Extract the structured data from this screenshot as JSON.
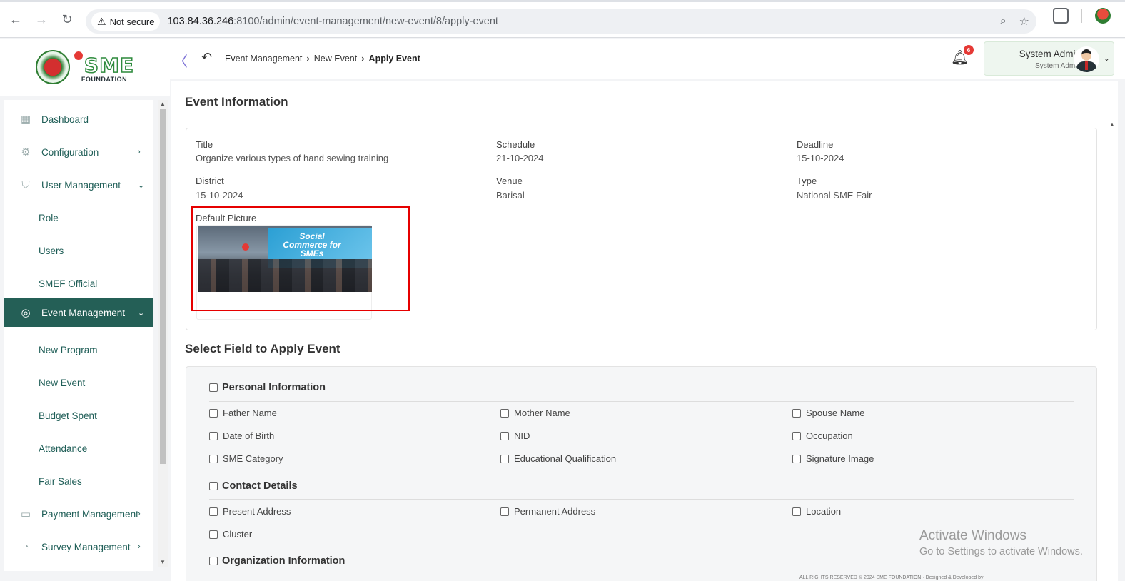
{
  "browser": {
    "security_label": "Not secure",
    "url_host": "103.84.36.246",
    "url_path": ":8100/admin/event-management/new-event/8/apply-event"
  },
  "header": {
    "breadcrumb": [
      "Event Management",
      "New Event",
      "Apply Event"
    ],
    "notification_count": "6",
    "user_name": "System Admin",
    "user_role": "System Admin",
    "logo_text": "SME",
    "logo_sub": "FOUNDATION"
  },
  "sidebar": {
    "items": [
      {
        "label": "Dashboard"
      },
      {
        "label": "Configuration"
      },
      {
        "label": "User Management"
      },
      {
        "label": "Role"
      },
      {
        "label": "Users"
      },
      {
        "label": "SMEF Official"
      },
      {
        "label": "Event Management"
      },
      {
        "label": "New Program"
      },
      {
        "label": "New Event"
      },
      {
        "label": "Budget Spent"
      },
      {
        "label": "Attendance"
      },
      {
        "label": "Fair Sales"
      },
      {
        "label": "Payment Management"
      },
      {
        "label": "Survey Management"
      }
    ]
  },
  "event_info": {
    "heading": "Event Information",
    "title_label": "Title",
    "title_value": "Organize various types of hand sewing training",
    "schedule_label": "Schedule",
    "schedule_value": "21-10-2024",
    "deadline_label": "Deadline",
    "deadline_value": "15-10-2024",
    "district_label": "District",
    "district_value": "15-10-2024",
    "venue_label": "Venue",
    "venue_value": "Barisal",
    "type_label": "Type",
    "type_value": "National SME Fair",
    "picture_label": "Default Picture",
    "picture_banner": "Social Commerce for SMEs"
  },
  "apply_fields": {
    "heading": "Select Field to Apply Event",
    "personal": {
      "title": "Personal Information",
      "fields": [
        "Father Name",
        "Mother Name",
        "Spouse Name",
        "Date of Birth",
        "NID",
        "Occupation",
        "SME Category",
        "Educational Qualification",
        "Signature Image"
      ]
    },
    "contact": {
      "title": "Contact Details",
      "fields": [
        "Present Address",
        "Permanent Address",
        "Location",
        "Cluster"
      ]
    },
    "organization": {
      "title": "Organization Information"
    }
  },
  "watermark": {
    "line1": "Activate Windows",
    "line2": "Go to Settings to activate Windows."
  },
  "footer": {
    "text": "ALL RIGHTS RESERVED © 2024 SME FOUNDATION · Designed & Developed by"
  }
}
